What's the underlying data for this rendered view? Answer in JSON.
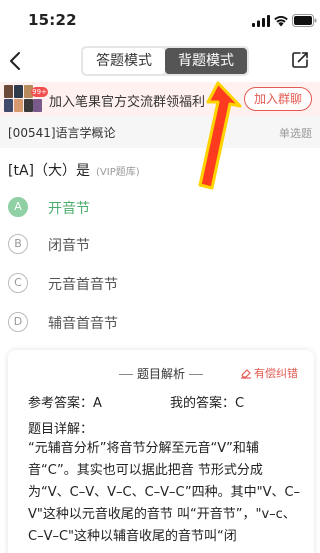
{
  "status_bar": {
    "time": "15:22"
  },
  "nav": {
    "back_icon": "chevron-left-icon",
    "modes": [
      "答题模式",
      "背题模式"
    ],
    "active_mode": "背题模式",
    "share_icon": "share-edit-icon"
  },
  "banner": {
    "badge": "99+",
    "text": "加入笔果官方交流群领福利",
    "button": "加入群聊",
    "accent": "#e35a52"
  },
  "question_header": {
    "code": "[00541]语言学概论",
    "type": "单选题"
  },
  "question": {
    "text": "[tA]（大）是",
    "tag": "(VIP题库)"
  },
  "options": [
    {
      "letter": "A",
      "text": "开音节",
      "correct": true
    },
    {
      "letter": "B",
      "text": "闭音节",
      "correct": false
    },
    {
      "letter": "C",
      "text": "元音首音节",
      "correct": false
    },
    {
      "letter": "D",
      "text": "辅音首音节",
      "correct": false
    }
  ],
  "analysis": {
    "title": "题目解析",
    "report": "有偿纠错",
    "ref_answer": "参考答案：A",
    "my_answer": "我的答案：C",
    "detail_title": "题目详解：",
    "detail_text": "“元辅音分析”将音节分解至元音“V”和辅音“C”。其实也可以据此把音 节形式分成为“V、C–V、V–C、C–V–C”四种。其中\"V、C–V\"这种以元音收尾的音节 叫“开音节”，\"v–c、C–V–C\"这种以辅音收尾的音节叫“闭"
  },
  "colors": {
    "correct": "#4cae6e",
    "active_tab": "#555555",
    "arrow_fill": "#ff3b1f",
    "arrow_stroke": "#ffd300"
  }
}
